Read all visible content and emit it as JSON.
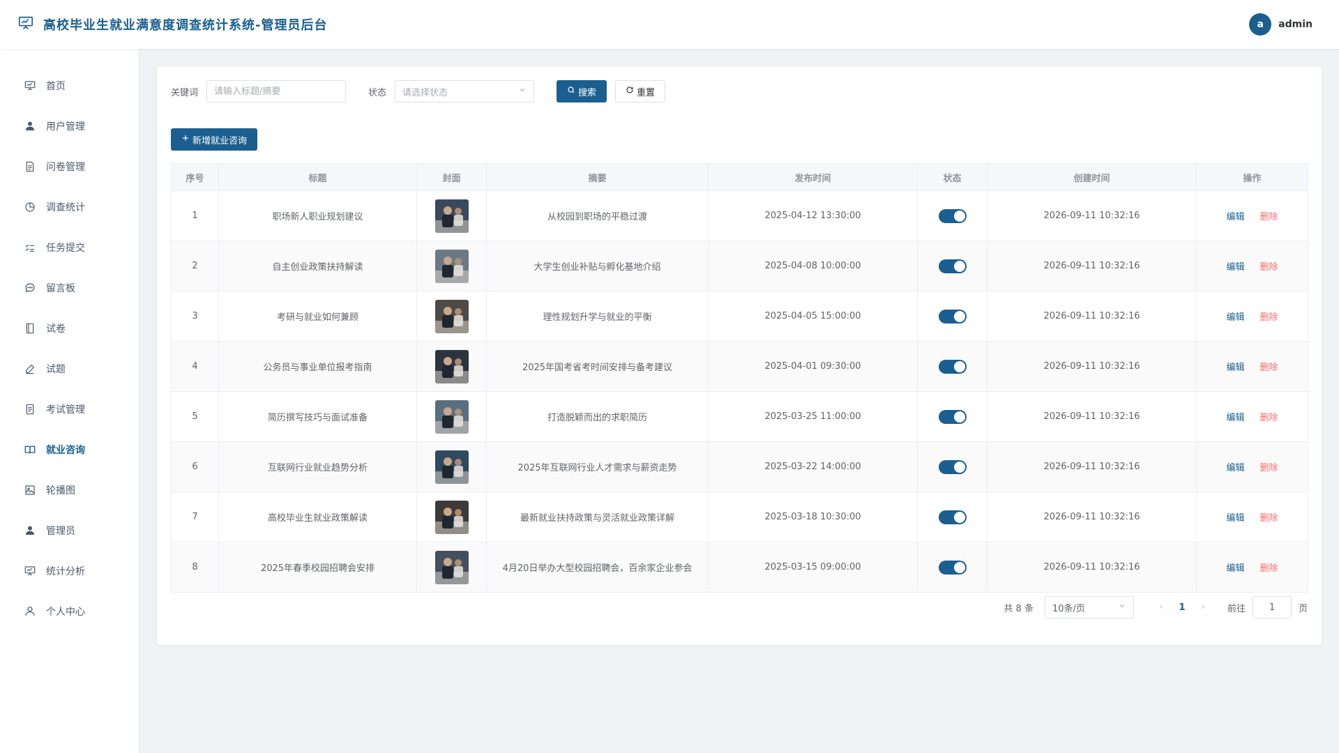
{
  "header": {
    "title": "高校毕业生就业满意度调查统计系统-管理员后台",
    "avatar_letter": "a",
    "username": "admin"
  },
  "sidebar": {
    "items": [
      {
        "label": "首页",
        "icon": "monitor-icon"
      },
      {
        "label": "用户管理",
        "icon": "user-icon"
      },
      {
        "label": "问卷管理",
        "icon": "document-icon"
      },
      {
        "label": "调查统计",
        "icon": "pie-chart-icon"
      },
      {
        "label": "任务提交",
        "icon": "checklist-icon"
      },
      {
        "label": "留言板",
        "icon": "chat-icon"
      },
      {
        "label": "试卷",
        "icon": "notebook-icon"
      },
      {
        "label": "试题",
        "icon": "edit-pen-icon"
      },
      {
        "label": "考试管理",
        "icon": "tickets-icon"
      },
      {
        "label": "就业咨询",
        "icon": "book-icon",
        "active": true
      },
      {
        "label": "轮播图",
        "icon": "picture-icon"
      },
      {
        "label": "管理员",
        "icon": "admin-user-icon"
      },
      {
        "label": "统计分析",
        "icon": "data-board-icon"
      },
      {
        "label": "个人中心",
        "icon": "person-icon"
      }
    ]
  },
  "filters": {
    "keyword_label": "关键词",
    "keyword_placeholder": "请输入标题/摘要",
    "keyword_value": "",
    "status_label": "状态",
    "status_placeholder": "请选择状态",
    "search_label": "搜索",
    "reset_label": "重置"
  },
  "add_button_label": "新增就业咨询",
  "table": {
    "headers": [
      "序号",
      "标题",
      "封面",
      "摘要",
      "发布时间",
      "状态",
      "创建时间",
      "操作"
    ],
    "edit_label": "编辑",
    "delete_label": "删除",
    "rows": [
      {
        "no": "1",
        "title": "职场新人职业规划建议",
        "summary": "从校园到职场的平稳过渡",
        "publish_time": "2025-04-12 13:30:00",
        "status": true,
        "created": "2026-09-11 10:32:16",
        "cover_color": "#3a4a5c"
      },
      {
        "no": "2",
        "title": "自主创业政策扶持解读",
        "summary": "大学生创业补贴与孵化基地介绍",
        "publish_time": "2025-04-08 10:00:00",
        "status": true,
        "created": "2026-09-11 10:32:16",
        "cover_color": "#6b7a86"
      },
      {
        "no": "3",
        "title": "考研与就业如何兼顾",
        "summary": "理性规划升学与就业的平衡",
        "publish_time": "2025-04-05 15:00:00",
        "status": true,
        "created": "2026-09-11 10:32:16",
        "cover_color": "#4e4a46"
      },
      {
        "no": "4",
        "title": "公务员与事业单位报考指南",
        "summary": "2025年国考省考时间安排与备考建议",
        "publish_time": "2025-04-01 09:30:00",
        "status": true,
        "created": "2026-09-11 10:32:16",
        "cover_color": "#2c3440"
      },
      {
        "no": "5",
        "title": "简历撰写技巧与面试准备",
        "summary": "打造脱颖而出的求职简历",
        "publish_time": "2025-03-25 11:00:00",
        "status": true,
        "created": "2026-09-11 10:32:16",
        "cover_color": "#5a6e80"
      },
      {
        "no": "6",
        "title": "互联网行业就业趋势分析",
        "summary": "2025年互联网行业人才需求与薪资走势",
        "publish_time": "2025-03-22 14:00:00",
        "status": true,
        "created": "2026-09-11 10:32:16",
        "cover_color": "#2f4a5e"
      },
      {
        "no": "7",
        "title": "高校毕业生就业政策解读",
        "summary": "最新就业扶持政策与灵活就业政策详解",
        "publish_time": "2025-03-18 10:30:00",
        "status": true,
        "created": "2026-09-11 10:32:16",
        "cover_color": "#3e3a38"
      },
      {
        "no": "8",
        "title": "2025年春季校园招聘会安排",
        "summary": "4月20日举办大型校园招聘会，百余家企业参会",
        "publish_time": "2025-03-15 09:00:00",
        "status": true,
        "created": "2026-09-11 10:32:16",
        "cover_color": "#44505e"
      }
    ]
  },
  "pagination": {
    "total_text": "共 8 条",
    "page_size": "10条/页",
    "current_page": "1",
    "goto_label": "前往",
    "goto_value": "1",
    "page_unit": "页"
  },
  "colors": {
    "primary": "#1a5f8f",
    "danger": "#f56c6c"
  }
}
